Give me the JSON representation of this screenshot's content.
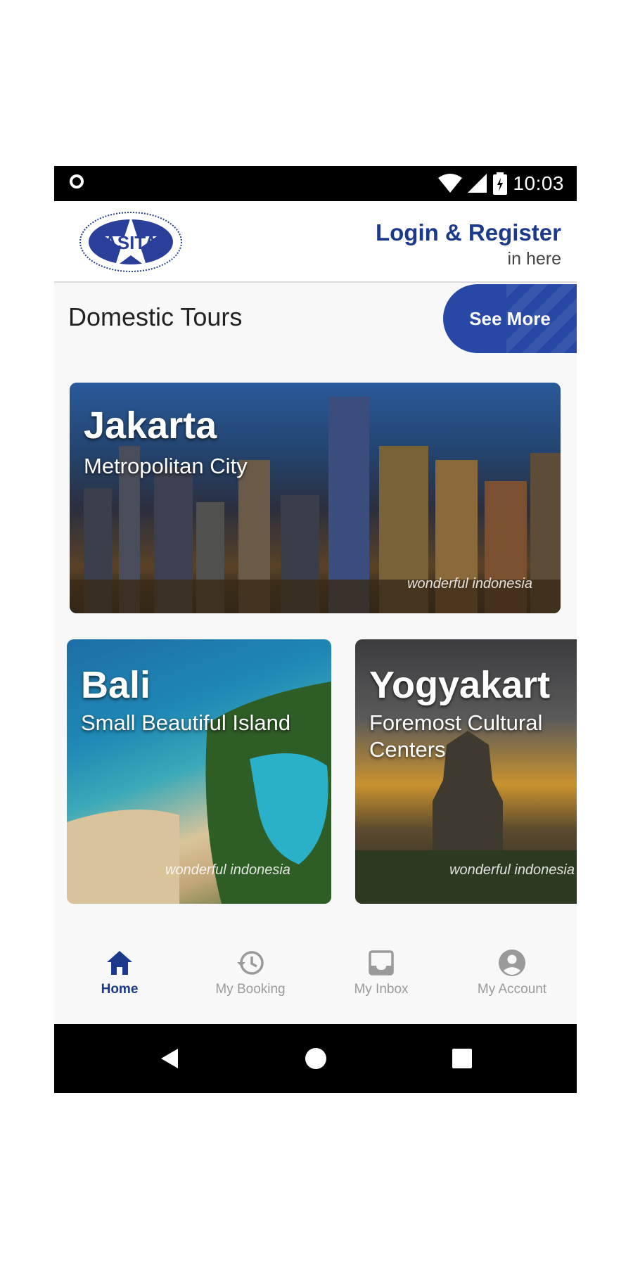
{
  "status_bar": {
    "time": "10:03"
  },
  "header": {
    "logo_text": "ASITA",
    "login_title": "Login & Register",
    "login_subtitle": "in here"
  },
  "section": {
    "title": "Domestic Tours",
    "see_more_label": "See More"
  },
  "cards": [
    {
      "title": "Jakarta",
      "subtitle": "Metropolitan City",
      "watermark": "wonderful indonesia"
    },
    {
      "title": "Bali",
      "subtitle": "Small Beautiful Island",
      "watermark": "wonderful indonesia"
    },
    {
      "title": "Yogyakart",
      "subtitle": "Foremost Cultural Centers",
      "watermark": "wonderful indonesia"
    }
  ],
  "bottom_nav": [
    {
      "label": "Home",
      "icon": "home-icon",
      "active": true
    },
    {
      "label": "My Booking",
      "icon": "history-icon",
      "active": false
    },
    {
      "label": "My Inbox",
      "icon": "inbox-icon",
      "active": false
    },
    {
      "label": "My Account",
      "icon": "account-icon",
      "active": false
    }
  ],
  "colors": {
    "brand": "#1c3a8c",
    "see_more_bg": "#2748a5",
    "inactive": "#9a9a9a"
  }
}
